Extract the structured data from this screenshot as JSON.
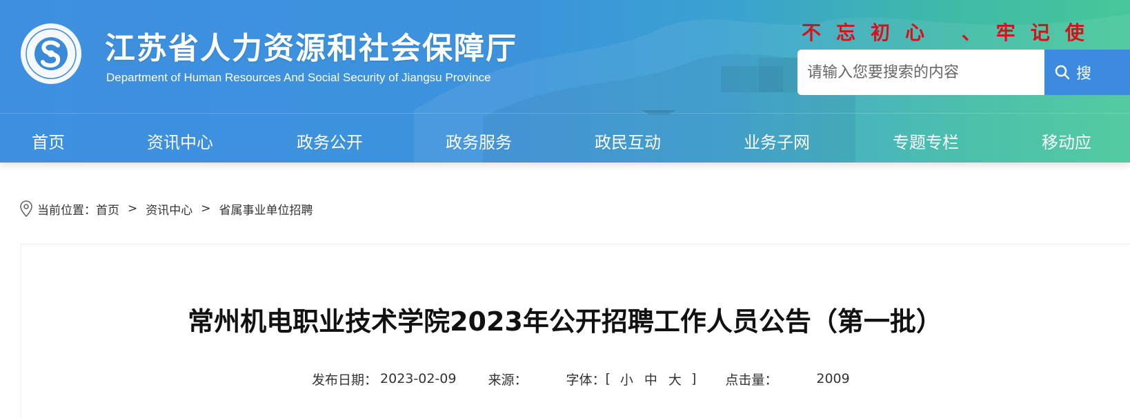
{
  "header": {
    "title": "江苏省人力资源和社会保障厅",
    "subtitle": "Department of Human Resources And Social Security of Jiangsu Province",
    "logo_text": "江苏省人力资源和社会保障厅",
    "slogan": "不忘初心 、牢记使",
    "colors": {
      "gradient_start": "#3e8fe0",
      "gradient_end": "#46c79a",
      "slogan": "#d8101a"
    }
  },
  "search": {
    "placeholder": "请输入您要搜索的内容",
    "button_label": "搜",
    "icon": "search-icon"
  },
  "nav": {
    "items": [
      {
        "label": "首页"
      },
      {
        "label": "资讯中心"
      },
      {
        "label": "政务公开"
      },
      {
        "label": "政务服务"
      },
      {
        "label": "政民互动"
      },
      {
        "label": "业务子网"
      },
      {
        "label": "专题专栏"
      },
      {
        "label": "移动应"
      }
    ]
  },
  "breadcrumb": {
    "icon": "location-pin-icon",
    "prefix": "当前位置：",
    "items": [
      "首页",
      "资讯中心",
      "省属事业单位招聘"
    ],
    "separator": ">"
  },
  "article": {
    "title": "常州机电职业技术学院2023年公开招聘工作人员公告（第一批）",
    "date_label": "发布日期：",
    "date": "2023-02-09",
    "source_label": "来源：",
    "source": "",
    "font_label": "字体：",
    "font_open": "[",
    "font_small": "小",
    "font_medium": "中",
    "font_large": "大",
    "font_close": "]",
    "clicks_label": "点击量：",
    "clicks": "2009"
  }
}
